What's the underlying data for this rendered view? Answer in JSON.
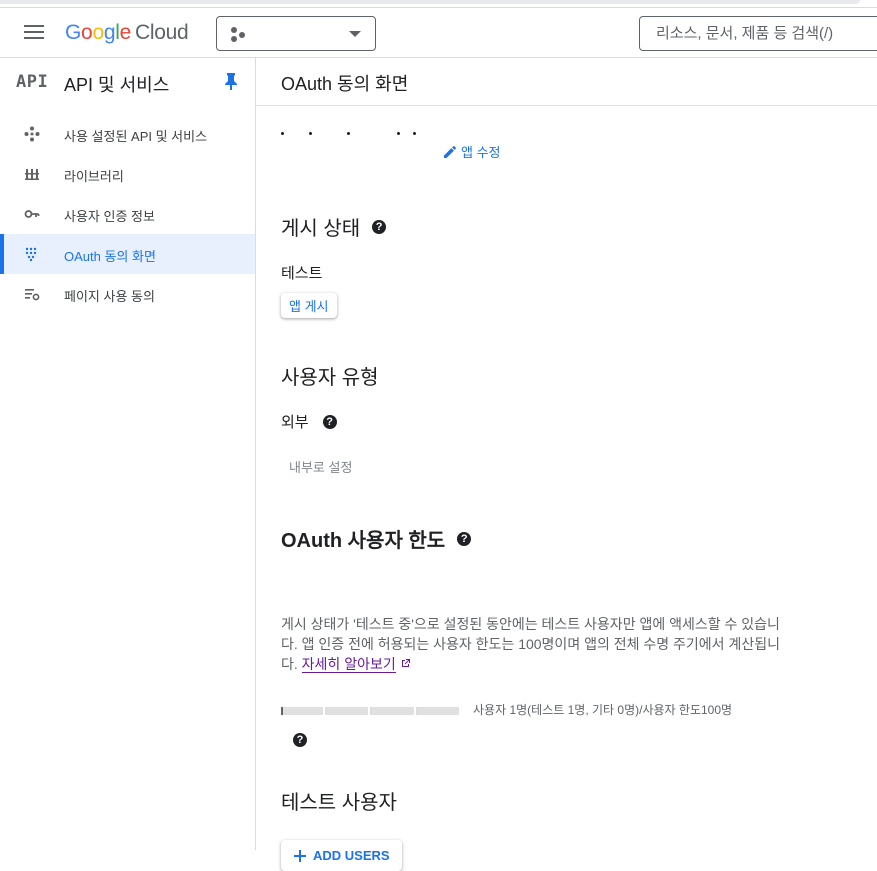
{
  "header": {
    "logo_google": "Google",
    "logo_cloud": "Cloud",
    "search_placeholder": "리소스, 문서, 제품 등 검색(/)"
  },
  "brand_colors": {
    "accent": "#1a73e8",
    "logo_blue": "#4285f4",
    "logo_red": "#ea4335",
    "logo_yellow": "#fbbc05",
    "logo_green": "#34a853"
  },
  "sidebar": {
    "mark": "API",
    "title": "API 및 서비스",
    "pin_icon": "pin-icon",
    "items": [
      {
        "label": "사용 설정된 API 및 서비스",
        "icon": "diamond-arrows-icon",
        "active": false
      },
      {
        "label": "라이브러리",
        "icon": "library-icon",
        "active": false
      },
      {
        "label": "사용자 인증 정보",
        "icon": "key-icon",
        "active": false
      },
      {
        "label": "OAuth 동의 화면",
        "icon": "dot-grid-icon",
        "active": true
      },
      {
        "label": "페이지 사용 동의",
        "icon": "list-settings-icon",
        "active": false
      }
    ]
  },
  "main": {
    "title": "OAuth 동의 화면",
    "edit_app": "앱 수정",
    "publish_section": {
      "title": "게시 상태",
      "status": "테스트",
      "publish_button": "앱 게시"
    },
    "user_type_section": {
      "title": "사용자 유형",
      "value": "외부",
      "make_internal": "내부로 설정"
    },
    "quota_section": {
      "title": "OAuth 사용자 한도",
      "description": "게시 상태가 '테스트 중'으로 설정된 동안에는 테스트 사용자만 앱에 액세스할 수 있습니다. 앱 인증 전에 허용되는 사용자 한도는 100명이며 앱의 전체 수명 주기에서 계산됩니다.",
      "learn_more": "자세히 알아보기",
      "usage_fraction": 0.01,
      "usage_text": "사용자 1명(테스트 1명, 기타 0명)/사용자 한도100명"
    },
    "test_users_section": {
      "title": "테스트 사용자",
      "add_button": "ADD USERS"
    }
  }
}
